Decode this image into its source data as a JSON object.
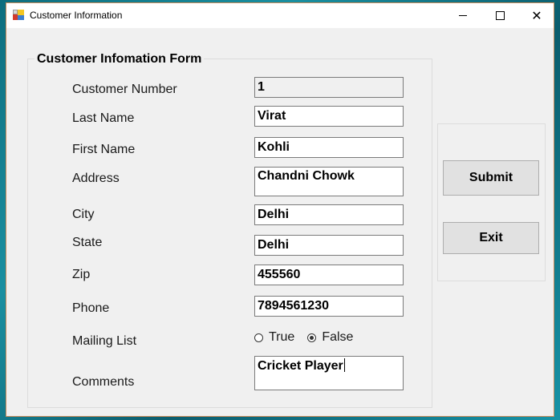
{
  "window": {
    "title": "Customer Information",
    "icon": "form-app-icon",
    "controls": {
      "minimize": "minimize-icon",
      "maximize": "maximize-icon",
      "close": "close-icon"
    }
  },
  "form": {
    "group_title": "Customer Infomation Form",
    "fields": {
      "customer_number": {
        "label": "Customer Number",
        "value": "1",
        "readonly": true
      },
      "last_name": {
        "label": "Last Name",
        "value": "Virat"
      },
      "first_name": {
        "label": "First Name",
        "value": "Kohli"
      },
      "address": {
        "label": "Address",
        "value": "Chandni Chowk"
      },
      "city": {
        "label": "City",
        "value": "Delhi"
      },
      "state": {
        "label": "State",
        "value": "Delhi"
      },
      "zip": {
        "label": "Zip",
        "value": "455560"
      },
      "phone": {
        "label": "Phone",
        "value": "7894561230"
      },
      "mailing_list": {
        "label": "Mailing List",
        "options": [
          {
            "label": "True",
            "checked": false
          },
          {
            "label": "False",
            "checked": true
          }
        ]
      },
      "comments": {
        "label": "Comments",
        "value": "Cricket Player"
      }
    }
  },
  "buttons": {
    "submit": "Submit",
    "exit": "Exit"
  }
}
